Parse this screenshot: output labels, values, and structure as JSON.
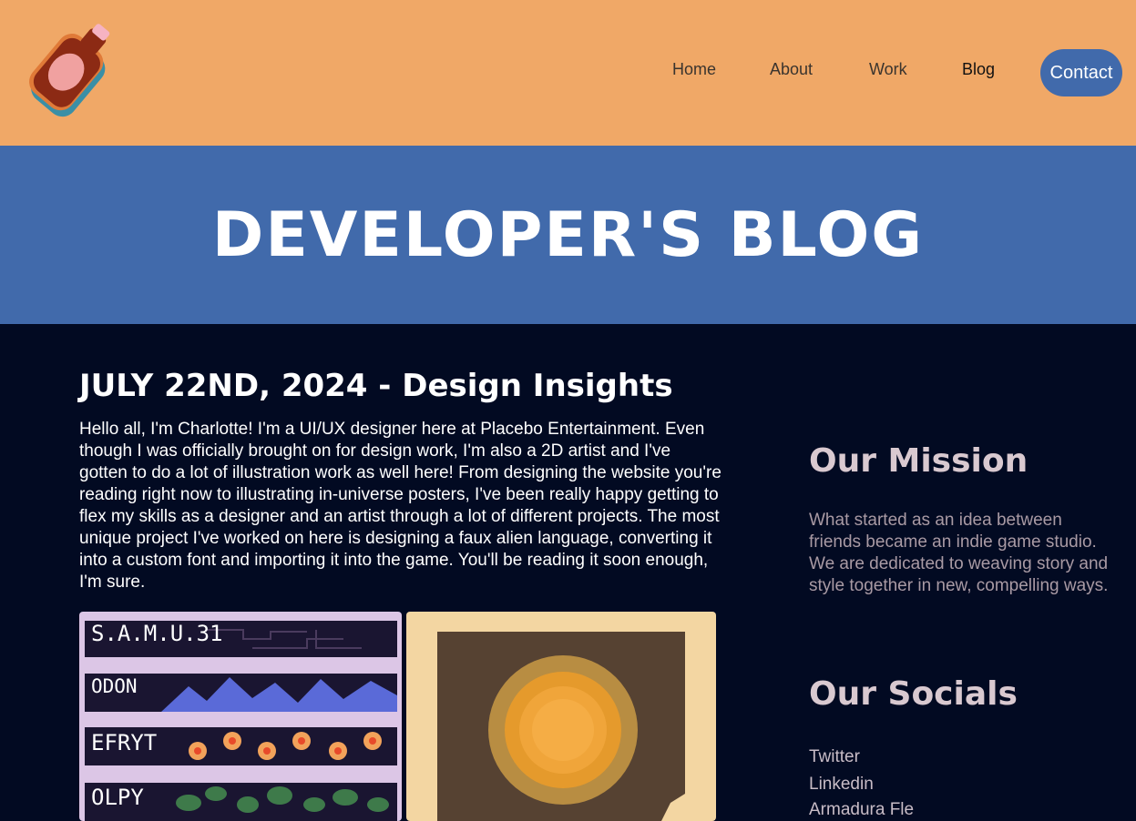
{
  "header": {
    "logo_alt": "Placebo Entertainment",
    "nav": {
      "home": "Home",
      "about": "About",
      "work": "Work",
      "blog": "Blog",
      "contact": "Contact"
    }
  },
  "banner": {
    "title": "DEVELOPER'S BLOG"
  },
  "post": {
    "title": "JULY 22ND, 2024 - Design Insights",
    "body": "Hello all, I'm Charlotte! I'm a UI/UX designer here at Placebo Entertainment. Even though I was officially brought on for design work, I'm also a 2D artist and I've gotten to do a lot of illustration work as well here! From designing the website you're reading right now to illustrating in-universe posters, I've been really happy getting to flex my skills as a designer and an artist through a lot of different projects. The most unique project I've worked on here is designing a faux alien language, converting it into a custom font and importing it into the game. You'll be reading it soon enough, I'm sure.",
    "alien_labels": [
      "S.A.M.U.31",
      "ODON",
      "EFRYT",
      "OLPY"
    ]
  },
  "sidebar": {
    "mission_heading": "Our Mission",
    "mission_text": "What started as an idea between friends became an indie game studio. We are dedicated to weaving story and style together in new, compelling ways.",
    "socials_heading": "Our Socials",
    "socials": [
      "Twitter",
      "Linkedin",
      "Armadura Fle"
    ]
  },
  "colors": {
    "header_bg": "#f0a867",
    "accent_blue": "#416aab",
    "page_bg": "#020a22"
  }
}
